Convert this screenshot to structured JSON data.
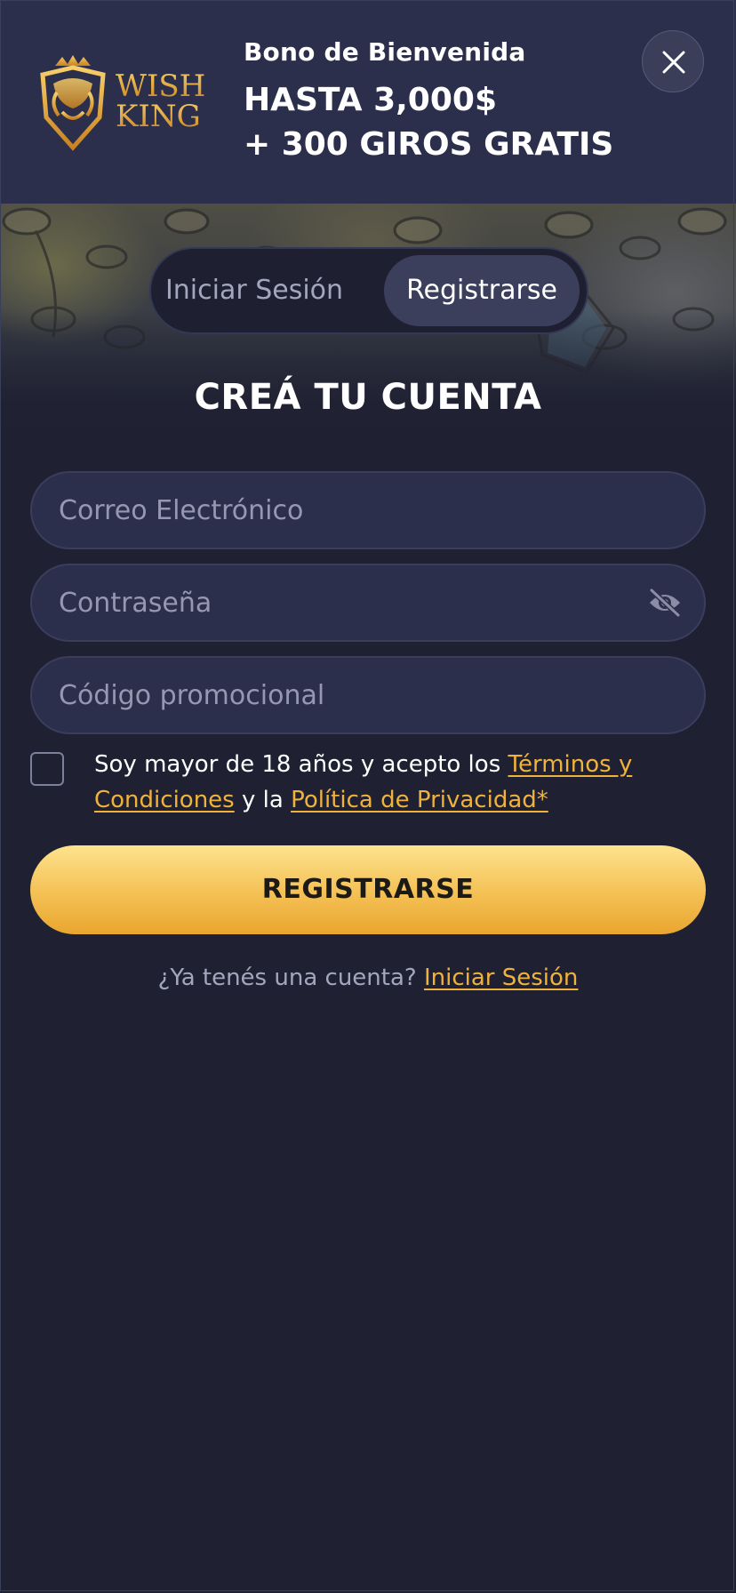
{
  "header": {
    "logo_text_line1": "WISH",
    "logo_text_line2": "KING",
    "bonus_subtitle": "Bono de Bienvenida",
    "bonus_line1": "HASTA 3,000$",
    "bonus_line2": "+ 300 GIROS GRATIS",
    "close_icon": "close-icon"
  },
  "tabs": {
    "login_label": "Iniciar Sesión",
    "register_label": "Registrarse",
    "active": "register"
  },
  "form": {
    "title": "CREÁ TU CUENTA",
    "email_placeholder": "Correo Electrónico",
    "email_value": "",
    "password_placeholder": "Contraseña",
    "password_value": "",
    "password_toggle_icon": "eye-off-icon",
    "promo_placeholder": "Código promocional",
    "promo_value": "",
    "consent_checked": false,
    "consent_prefix": "Soy mayor de 18 años y acepto los ",
    "terms_link": "Términos y Condiciones",
    "consent_middle": " y la ",
    "privacy_link": "Política de Privacidad*",
    "submit_label": "REGISTRARSE",
    "account_question": "¿Ya tenés una cuenta? ",
    "login_link": "Iniciar Sesión"
  },
  "colors": {
    "background": "#1f2133",
    "header_bg": "#2c2f4b",
    "accent_gold": "#f0b23a",
    "button_gradient_top": "#fde38d",
    "button_gradient_bottom": "#e9a62e"
  }
}
